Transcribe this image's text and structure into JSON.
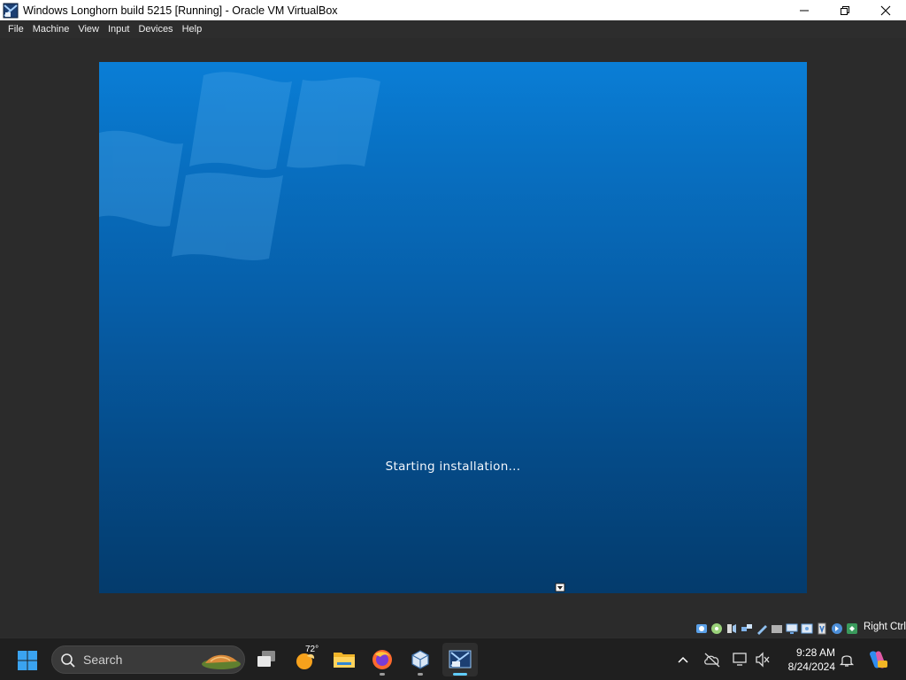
{
  "window": {
    "title": "Windows Longhorn build 5215 [Running] - Oracle VM VirtualBox"
  },
  "menu": {
    "items": [
      {
        "label": "File"
      },
      {
        "label": "Machine"
      },
      {
        "label": "View"
      },
      {
        "label": "Input"
      },
      {
        "label": "Devices"
      },
      {
        "label": "Help"
      }
    ]
  },
  "vm": {
    "status_text": "Starting installation..."
  },
  "status_bar": {
    "host_key": "Right Ctrl",
    "icons": [
      "hard-disk-icon",
      "optical-drive-icon",
      "audio-icon",
      "network-icon",
      "usb-icon",
      "shared-folders-icon",
      "display-icon",
      "recording-icon",
      "cpu-icon",
      "mouse-integration-icon",
      "keyboard-icon"
    ]
  },
  "taskbar": {
    "search_placeholder": "Search",
    "weather_temp": "72°",
    "apps": [
      "task-view",
      "weather",
      "file-explorer",
      "firefox",
      "virtualbox",
      "virtualbox-vm-window"
    ]
  },
  "tray": {
    "time": "9:28 AM",
    "date": "8/24/2024"
  },
  "colors": {
    "vm_screen_top": "#0a7ed6",
    "vm_screen_bottom": "#043b6c",
    "taskbar_bg": "#1f1f1f",
    "active_indicator": "#60cdff"
  }
}
